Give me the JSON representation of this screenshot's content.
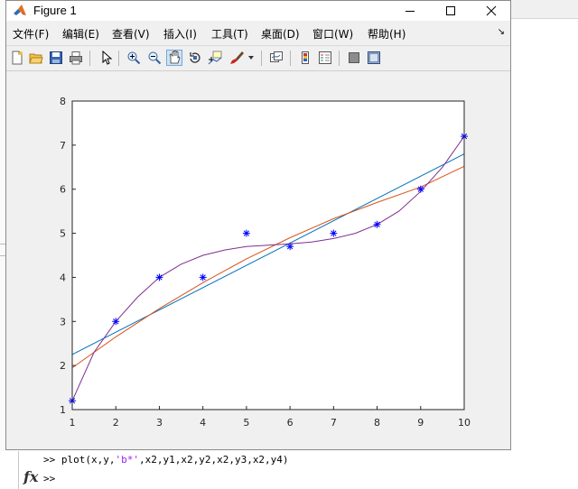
{
  "window": {
    "title": "Figure 1",
    "controls": {
      "minimize": "minimize",
      "maximize": "maximize",
      "close": "close"
    }
  },
  "menu": [
    {
      "label": "文件(F)"
    },
    {
      "label": "编辑(E)"
    },
    {
      "label": "查看(V)"
    },
    {
      "label": "插入(I)"
    },
    {
      "label": "工具(T)"
    },
    {
      "label": "桌面(D)"
    },
    {
      "label": "窗口(W)"
    },
    {
      "label": "帮助(H)"
    }
  ],
  "toolbar": {
    "buttons": [
      {
        "icon": "new-figure-icon"
      },
      {
        "icon": "open-file-icon"
      },
      {
        "icon": "save-icon"
      },
      {
        "icon": "print-icon"
      },
      {
        "icon": "pointer-icon"
      },
      {
        "icon": "zoom-in-icon"
      },
      {
        "icon": "zoom-out-icon"
      },
      {
        "icon": "pan-icon",
        "active": true
      },
      {
        "icon": "rotate-3d-icon"
      },
      {
        "icon": "data-cursor-icon"
      },
      {
        "icon": "brush-icon"
      },
      {
        "icon": "link-plot-icon"
      },
      {
        "icon": "colorbar-icon"
      },
      {
        "icon": "legend-icon"
      },
      {
        "icon": "hide-plot-tools-icon"
      },
      {
        "icon": "show-plot-tools-icon"
      }
    ]
  },
  "chart_data": {
    "type": "line",
    "xlim": [
      1,
      10
    ],
    "ylim": [
      1,
      8
    ],
    "xticks": [
      1,
      2,
      3,
      4,
      5,
      6,
      7,
      8,
      9,
      10
    ],
    "yticks": [
      1,
      2,
      3,
      4,
      5,
      6,
      7,
      8
    ],
    "grid": false,
    "series": [
      {
        "marker": "*",
        "line": "none",
        "color": "#0000ff",
        "x": [
          1,
          2,
          3,
          4,
          5,
          6,
          7,
          8,
          9,
          10
        ],
        "y": [
          1.2,
          3,
          4,
          4,
          5,
          4.7,
          5,
          5.2,
          6,
          7.2
        ]
      },
      {
        "color": "#0072bd",
        "fit": "linear",
        "x": [
          1,
          10
        ],
        "y": [
          2.25,
          6.8
        ]
      },
      {
        "color": "#d95319",
        "fit": "quadratic",
        "x": [
          1,
          2,
          3,
          4,
          5,
          6,
          7,
          8,
          9,
          10
        ],
        "y": [
          1.95,
          2.65,
          3.29,
          3.88,
          4.42,
          4.9,
          5.33,
          5.7,
          6.05,
          6.52
        ]
      },
      {
        "color": "#7e2f8e",
        "fit": "cubic",
        "x": [
          1,
          1.5,
          2,
          2.5,
          3,
          3.5,
          4,
          4.5,
          5,
          5.5,
          6,
          6.5,
          7,
          7.5,
          8,
          8.5,
          9,
          9.5,
          10
        ],
        "y": [
          1.2,
          2.3,
          3.0,
          3.55,
          4.0,
          4.3,
          4.5,
          4.62,
          4.7,
          4.73,
          4.76,
          4.8,
          4.88,
          5.0,
          5.2,
          5.5,
          5.95,
          6.5,
          7.2
        ]
      }
    ]
  },
  "command_window": {
    "prompt": ">>",
    "history_command_pre": "plot(x,y,",
    "history_command_str": "'b*'",
    "history_command_post": ",x2,y1,x2,y2,x2,y3,x2,y4)",
    "fx_label": "fx"
  }
}
